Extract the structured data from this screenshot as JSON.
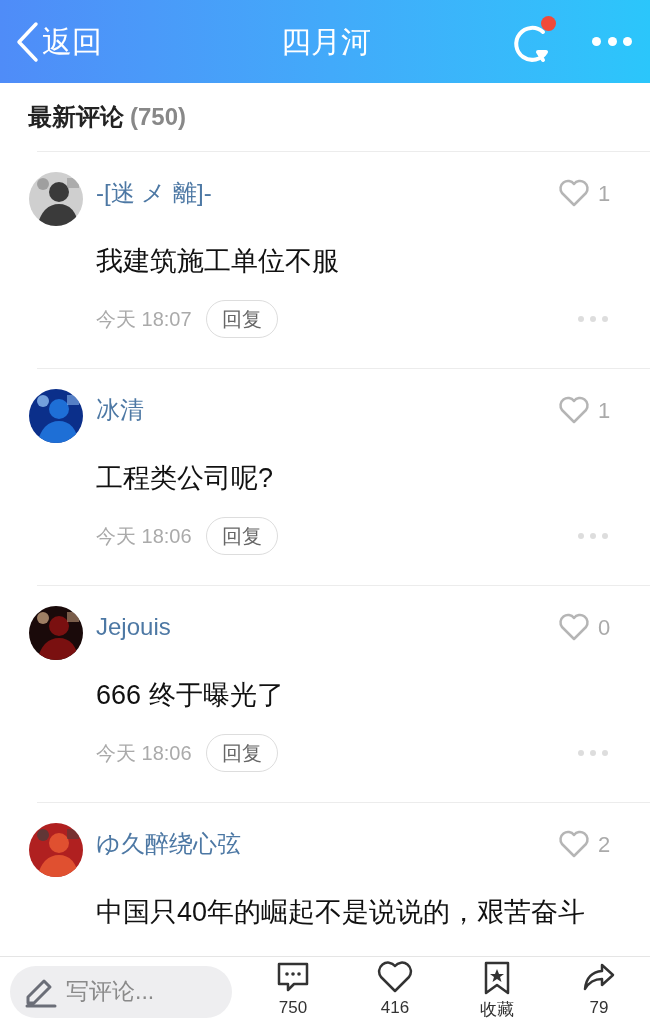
{
  "header": {
    "back": "返回",
    "title": "四月河",
    "has_notification": true
  },
  "section": {
    "title": "最新评论",
    "count": "(750)"
  },
  "comments": [
    {
      "user": "-[迷 メ 離]-",
      "likes": "1",
      "text": "我建筑施工单位不服",
      "time": "今天 18:07",
      "reply": "回复"
    },
    {
      "user": "冰清",
      "likes": "1",
      "text": "工程类公司呢?",
      "time": "今天 18:06",
      "reply": "回复"
    },
    {
      "user": "Jejouis",
      "likes": "0",
      "text": "666 终于曝光了",
      "time": "今天 18:06",
      "reply": "回复"
    },
    {
      "user": "ゆ久醉绕心弦",
      "likes": "2",
      "text": "中国只40年的崛起不是说说的，艰苦奋斗"
    }
  ],
  "bottom_bar": {
    "placeholder": "写评论...",
    "actions": [
      {
        "kind": "comment",
        "label": "750"
      },
      {
        "kind": "like",
        "label": "416"
      },
      {
        "kind": "favorite",
        "label": "收藏"
      },
      {
        "kind": "share",
        "label": "79"
      }
    ]
  }
}
